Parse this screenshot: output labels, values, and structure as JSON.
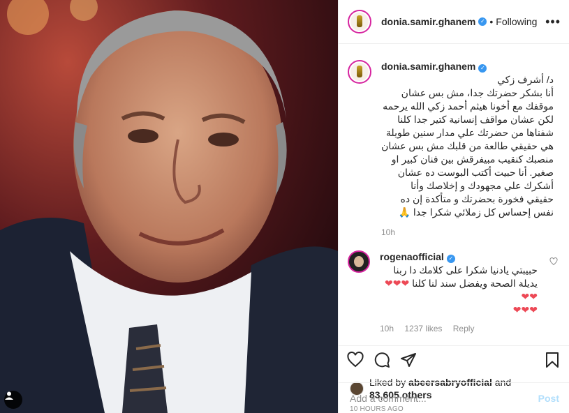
{
  "header": {
    "username": "donia.samir.ghanem",
    "separator": "•",
    "follow_status": "Following",
    "more_label": "•••"
  },
  "caption": {
    "username": "donia.samir.ghanem",
    "text": "د/ أشرف زكي\nأنا بشكر حضرتك جدا، مش بس عشان موقفك مع أخونا هيثم أحمد زكي الله يرحمه لكن عشان مواقف إنسانية كتير جدا كلنا شفناها من حضرتك علي مدار سنين طويلة هي حقيقي طالعة من قلبك مش بس عشان منصبك كنقيب مبيفرقش بين فنان كبير او صغير. أنا حبيت أكتب البوست ده عشان أشكرك علي مجهودك و إخلاصك وأنا حقيقي فخورة بحضرتك و متأكدة إن ده نفس إحساس كل زملائي شكرا جدا 🙏",
    "time": "10h"
  },
  "reply": {
    "username": "rogenaofficial",
    "text": "حبيبتي يادنيا شكرا على كلامك دا ربنا يديلة الصحة ويفضل سند لنا كلنا ❤❤❤❤❤\n❤❤❤",
    "time": "10h",
    "likes": "1237 likes",
    "reply_label": "Reply"
  },
  "likes": {
    "prefix": "Liked by ",
    "liker": "abeersabryofficial",
    "middle": " and",
    "others": "83,605 others"
  },
  "timestamp": "10 HOURS AGO",
  "comment_box": {
    "placeholder": "Add a comment...",
    "post_label": "Post"
  },
  "icons": {
    "like": "heart-icon",
    "comment": "comment-icon",
    "share": "share-icon",
    "save": "bookmark-icon",
    "tag": "user-tag-icon"
  },
  "colors": {
    "verified": "#3897f0",
    "post_button": "#b2dffc",
    "meta_text": "#8e8e8e",
    "heart_red": "#ed4956"
  }
}
